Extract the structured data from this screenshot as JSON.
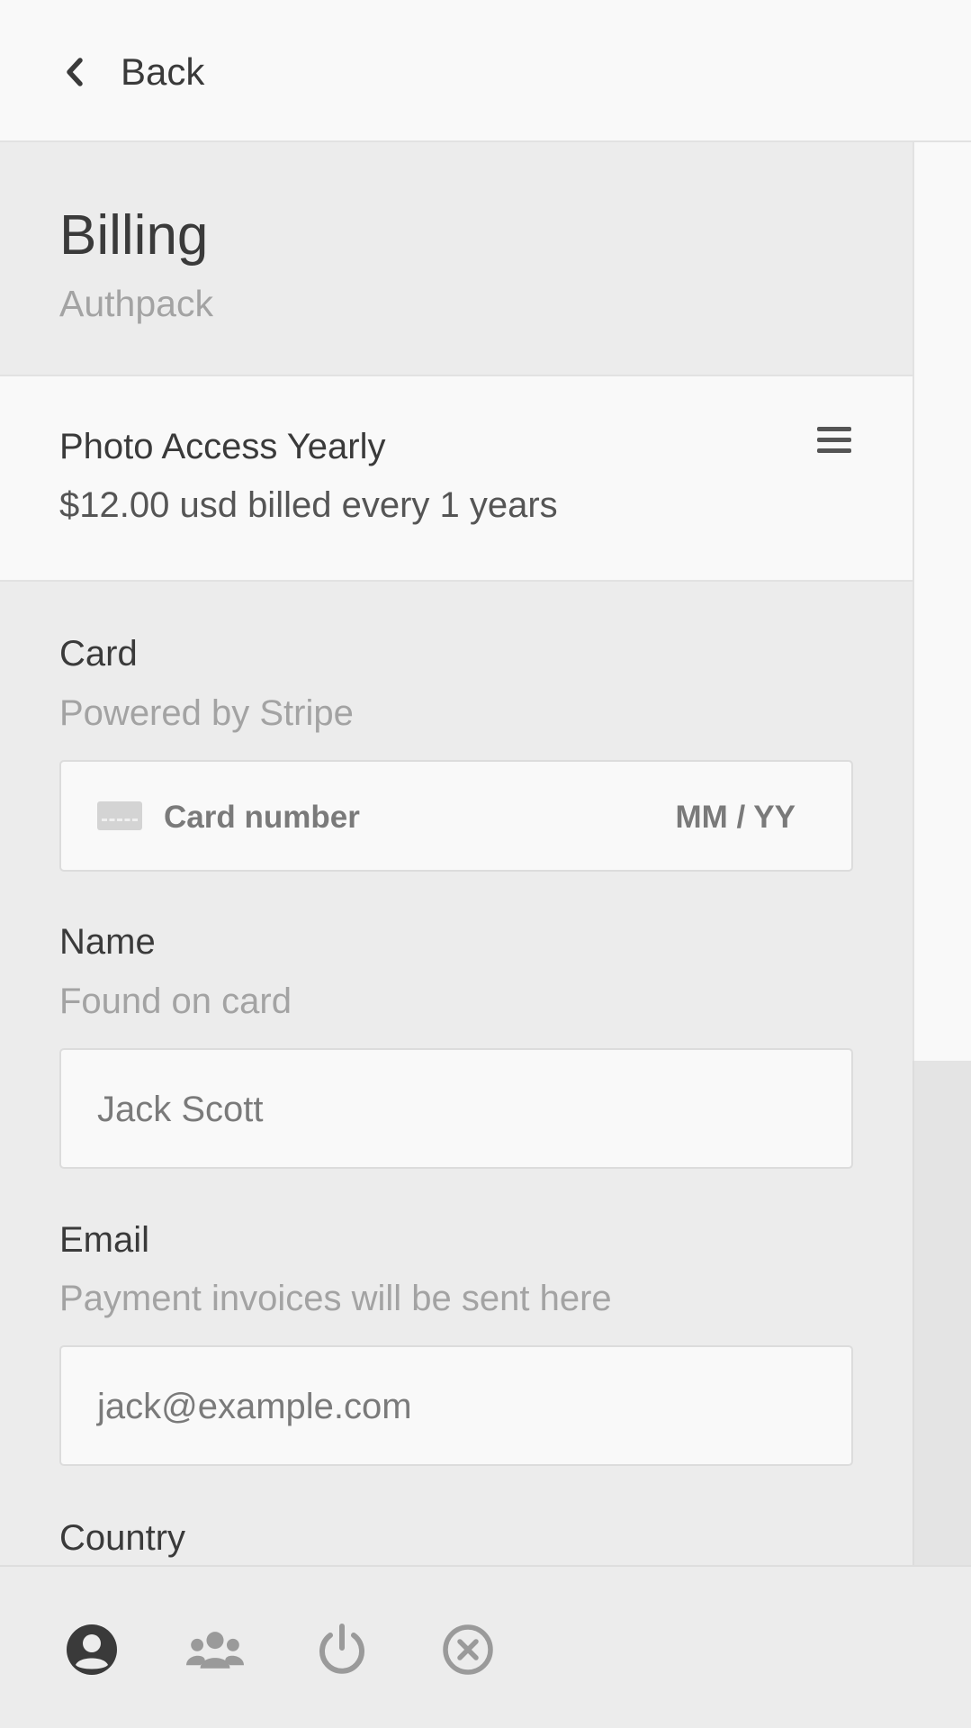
{
  "topbar": {
    "back_label": "Back"
  },
  "header": {
    "title": "Billing",
    "subtitle": "Authpack"
  },
  "plan": {
    "name": "Photo Access Yearly",
    "price": "$12.00 usd billed every 1 years",
    "menu_icon": "hamburger-menu-icon"
  },
  "card_field": {
    "label": "Card",
    "hint": "Powered by Stripe",
    "number_placeholder": "Card number",
    "expiry_placeholder": "MM / YY",
    "icon": "credit-card-icon"
  },
  "name_field": {
    "label": "Name",
    "hint": "Found on card",
    "placeholder": "Jack Scott"
  },
  "email_field": {
    "label": "Email",
    "hint": "Payment invoices will be sent here",
    "placeholder": "jack@example.com"
  },
  "country_field": {
    "label": "Country"
  },
  "bottom_nav": {
    "items": [
      {
        "icon": "user-circle-icon",
        "active": true
      },
      {
        "icon": "users-group-icon",
        "active": false
      },
      {
        "icon": "power-icon",
        "active": false
      },
      {
        "icon": "close-circle-icon",
        "active": false
      }
    ]
  },
  "colors": {
    "background": "#ececec",
    "surface": "#f9f9f9",
    "text_primary": "#3a3a3a",
    "text_muted": "#a3a3a3",
    "icon_active": "#3a3a3a",
    "icon_inactive": "#9a9a9a"
  }
}
